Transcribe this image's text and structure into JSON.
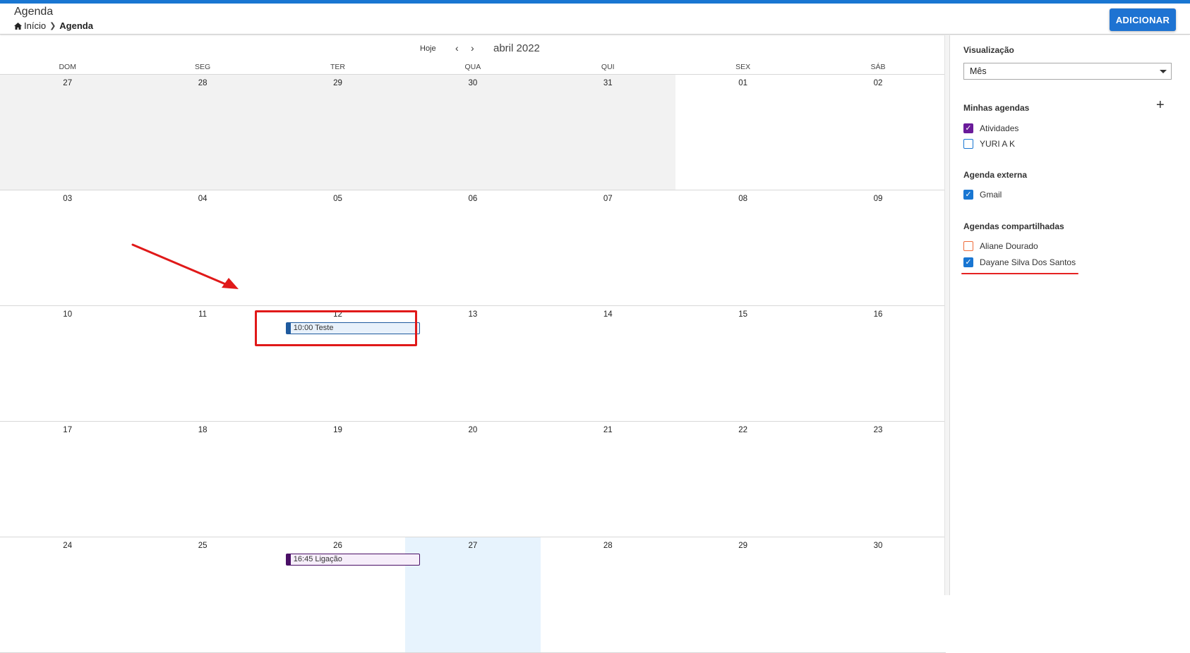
{
  "header": {
    "title": "Agenda",
    "breadcrumb": {
      "home": "Início",
      "current": "Agenda"
    },
    "add_label": "ADICIONAR"
  },
  "calendar": {
    "today_label": "Hoje",
    "month_title": "abril 2022",
    "weekdays": [
      "DOM",
      "SEG",
      "TER",
      "QUA",
      "QUI",
      "SEX",
      "SÁB"
    ],
    "weeks": [
      [
        "27",
        "28",
        "29",
        "30",
        "31",
        "01",
        "02"
      ],
      [
        "03",
        "04",
        "05",
        "06",
        "07",
        "08",
        "09"
      ],
      [
        "10",
        "11",
        "12",
        "13",
        "14",
        "15",
        "16"
      ],
      [
        "17",
        "18",
        "19",
        "20",
        "21",
        "22",
        "23"
      ],
      [
        "24",
        "25",
        "26",
        "27",
        "28",
        "29",
        "30"
      ]
    ],
    "events": [
      {
        "label": "10:00 Teste"
      },
      {
        "label": "16:45 Ligação"
      }
    ]
  },
  "sidebar": {
    "view_label": "Visualização",
    "view_value": "Mês",
    "my_calendars_label": "Minhas agendas",
    "my_calendars": [
      {
        "name": "Atividades",
        "checked": true
      },
      {
        "name": "YURI A K",
        "checked": false
      }
    ],
    "external_label": "Agenda externa",
    "external": [
      {
        "name": "Gmail",
        "checked": true
      }
    ],
    "shared_label": "Agendas compartilhadas",
    "shared": [
      {
        "name": "Aliane Dourado",
        "checked": false
      },
      {
        "name": "Dayane Silva Dos Santos",
        "checked": true
      }
    ]
  },
  "colors": {
    "accent": "#1976d2",
    "event_blue": "#1f5a9e",
    "event_purple": "#4a0f66",
    "today_bg": "#e7f3fd",
    "other_month_bg": "#f2f2f2",
    "annotation_red": "#e01919"
  },
  "icons": [
    "home-icon",
    "chevron-right-icon",
    "chevron-left-icon",
    "plus-icon",
    "dropdown-caret-icon",
    "checkbox-icon"
  ]
}
